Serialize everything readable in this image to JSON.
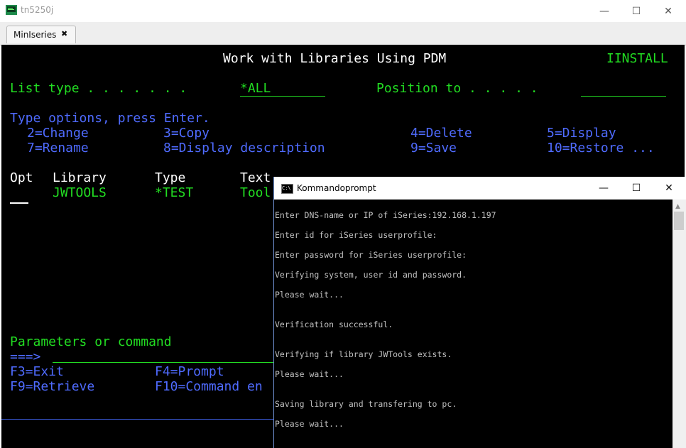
{
  "window": {
    "title": "tn5250j",
    "tab_label": "MinIseries",
    "tab_close": "✖",
    "minimize": "—",
    "maximize": "☐",
    "close": "✕"
  },
  "terminal": {
    "screen_title": "Work with Libraries Using PDM",
    "system_name": "IINSTALL",
    "list_type_label": "List type . . . . . . .",
    "list_type_value": "*ALL",
    "position_label": "Position to . . . . .",
    "type_options": "Type options, press Enter.",
    "options": [
      "2=Change",
      "3=Copy",
      "4=Delete",
      "5=Display",
      "7=Rename",
      "8=Display description",
      "9=Save",
      "10=Restore ..."
    ],
    "columns": [
      "Opt",
      "Library",
      "Type",
      "Text"
    ],
    "rows": [
      {
        "library": "JWTOOLS",
        "type": "*TEST",
        "text": "Tool"
      }
    ],
    "params_label": "Parameters or command",
    "prompt_arrow": "===>",
    "fkeys": [
      "F3=Exit",
      "F4=Prompt",
      "F9=Retrieve",
      "F10=Command en"
    ]
  },
  "cmd": {
    "title": "Kommandoprompt",
    "icon_text": "C:\\",
    "minimize": "—",
    "maximize": "☐",
    "close": "✕",
    "lines": [
      "Enter DNS-name or IP of iSeries:192.168.1.197",
      "Enter id for iSeries userprofile:",
      "Enter password for iSeries userprofile:",
      "Verifying system, user id and password.",
      "Please wait...",
      "Verification successful.",
      "Verifying if library JWTools exists.",
      "Please wait...",
      "Saving library and transfering to pc.",
      "Please wait..."
    ],
    "scroll_up": "▲"
  },
  "colors": {
    "terminal_green": "#22dd22",
    "terminal_blue": "#4f6bff",
    "terminal_white": "#ffffff",
    "cmd_text": "#c0c0c0"
  }
}
